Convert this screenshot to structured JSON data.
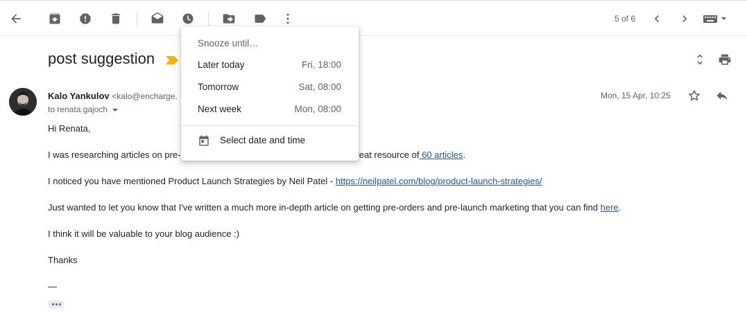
{
  "toolbar": {
    "page_count": "5 of 6",
    "icons": [
      "back-arrow-icon",
      "archive-icon",
      "report-spam-icon",
      "delete-icon",
      "mark-unread-icon",
      "snooze-icon",
      "move-to-icon",
      "label-icon",
      "more-vert-icon",
      "chevron-left-icon",
      "chevron-right-icon",
      "keyboard-icon"
    ]
  },
  "email": {
    "subject": "post suggestion",
    "sender_name": "Kalo Yankulov",
    "sender_email": "<kalo@encharge.",
    "to": "to renata.gajoch",
    "date": "Mon, 15 Apr, 10:25",
    "body": {
      "greeting": "Hi Renata,",
      "p1_text": "I was researching articles on pre-launch marketing and stumbled upon your great resource of",
      "p1_link": " 60 articles",
      "p1_end": ".",
      "p2_text": "I noticed you have mentioned Product Launch Strategies by Neil Patel - ",
      "p2_link": "https://neilpatel.com/blog/product-launch-strategies/",
      "p3_text": "Just wanted to let you know that I've written a much more in-depth article on getting pre-orders and pre-launch marketing that you can find ",
      "p3_link": "here",
      "p3_end": ".",
      "p4_text": "I think it will be valuable to your blog audience :)",
      "p5_text": "Thanks",
      "signature_dash": "—"
    }
  },
  "snooze_menu": {
    "title": "Snooze until…",
    "items": [
      {
        "label": "Later today",
        "time": "Fri, 18:00"
      },
      {
        "label": "Tomorrow",
        "time": "Sat, 08:00"
      },
      {
        "label": "Next week",
        "time": "Mon, 08:00"
      }
    ],
    "custom_label": "Select date and time"
  },
  "colors": {
    "link": "#1155cc",
    "label_tag": "#f4b400",
    "icon": "#5f6368"
  }
}
